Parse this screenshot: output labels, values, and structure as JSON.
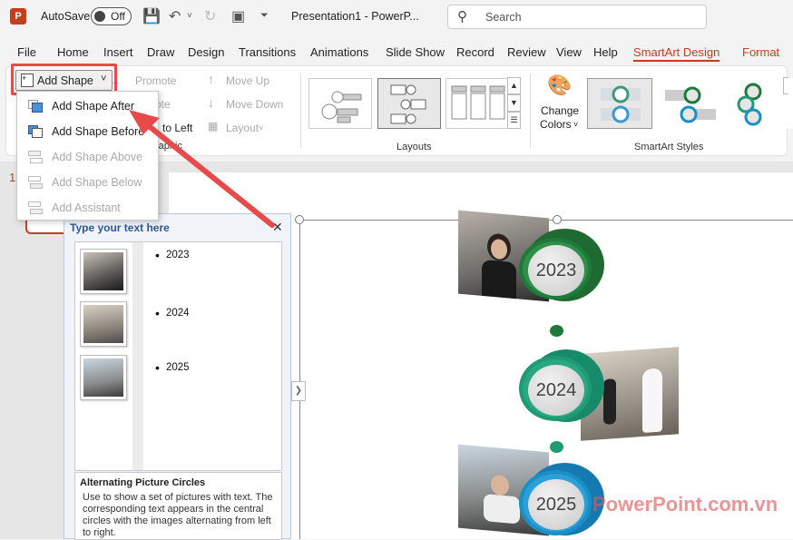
{
  "titlebar": {
    "autosave_label": "AutoSave",
    "toggle_state": "Off",
    "doc_title": "Presentation1  -  PowerP...",
    "search_placeholder": "Search"
  },
  "menu": {
    "items": [
      "File",
      "Home",
      "Insert",
      "Draw",
      "Design",
      "Transitions",
      "Animations",
      "Slide Show",
      "Record",
      "Review",
      "View",
      "Help",
      "SmartArt Design",
      "Format"
    ]
  },
  "ribbon": {
    "add_shape": "Add Shape",
    "promote": "Promote",
    "demote_partial": "ote",
    "move_up": "Move Up",
    "move_down": "Move Down",
    "right_to_left_partial": "to Left",
    "layout": "Layout",
    "create_graphic_partial": "raphic",
    "layouts_group": "Layouts",
    "change_colors_line1": "Change",
    "change_colors_line2": "Colors",
    "smartart_styles_group": "SmartArt Styles"
  },
  "dropdown": {
    "items": [
      {
        "label": "Add Shape After",
        "enabled": true
      },
      {
        "label": "Add Shape Before",
        "enabled": true
      },
      {
        "label": "Add Shape Above",
        "enabled": false
      },
      {
        "label": "Add Shape Below",
        "enabled": false
      },
      {
        "label": "Add Assistant",
        "enabled": false
      }
    ]
  },
  "slides": {
    "thumb_number": "1"
  },
  "textpane": {
    "title": "Type your text here",
    "bullets": [
      "2023",
      "2024",
      "2025"
    ],
    "desc_title": "Alternating Picture Circles",
    "desc_body": "Use to show a set of pictures with text. The corresponding text appears in the central circles with the images alternating from left to right."
  },
  "smartart": {
    "years": [
      "2023",
      "2024",
      "2025"
    ],
    "colors": [
      "#1e7a3a",
      "#1f9a72",
      "#1a8fc4"
    ]
  },
  "watermark": "PowerPoint.com.vn",
  "colors": {
    "accent": "#c43e1c",
    "highlight": "#e84a4a"
  }
}
